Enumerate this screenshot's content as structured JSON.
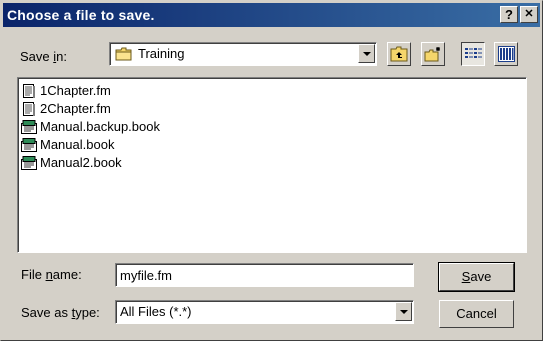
{
  "window": {
    "title": "Choose a file to save."
  },
  "titlebar": {
    "help_label": "?",
    "close_label": "✕"
  },
  "save_in": {
    "label_pre": "Save ",
    "label_ul": "i",
    "label_post": "n:",
    "value": "Training",
    "folder_icon": "folder-icon"
  },
  "toolbar": {
    "up_icon": "up-one-level-icon",
    "new_folder_icon": "new-folder-icon",
    "list_icon": "list-view-icon",
    "details_icon": "details-view-icon"
  },
  "files": [
    {
      "name": "1Chapter.fm",
      "icon": "document-icon"
    },
    {
      "name": "2Chapter.fm",
      "icon": "document-icon"
    },
    {
      "name": "Manual.backup.book",
      "icon": "book-icon"
    },
    {
      "name": "Manual.book",
      "icon": "book-icon"
    },
    {
      "name": "Manual2.book",
      "icon": "book-icon"
    }
  ],
  "file_name": {
    "label_pre": "File ",
    "label_ul": "n",
    "label_post": "ame:",
    "value": "myfile.fm"
  },
  "save_as_type": {
    "label_pre": "Save as ",
    "label_ul": "t",
    "label_post": "ype:",
    "value": "All Files (*.*)"
  },
  "buttons": {
    "save_ul": "S",
    "save_rest": "ave",
    "cancel": "Cancel"
  },
  "colors": {
    "title_start": "#0a246a",
    "title_end": "#3a6ea5",
    "face": "#d4d0c8"
  }
}
